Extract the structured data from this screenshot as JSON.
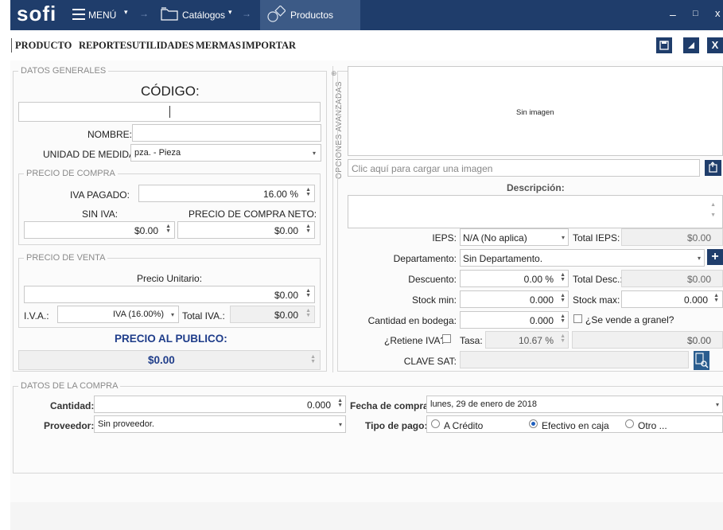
{
  "app": {
    "logo": "sofi",
    "menu_label": "MENÚ",
    "catalogos_label": "Catálogos",
    "productos_label": "Productos",
    "window_controls": {
      "minimize": "–",
      "maximize": "□",
      "close": "x"
    }
  },
  "menubar": {
    "items": [
      "PRODUCTO",
      "REPORTES",
      "UTILIDADES",
      "MERMAS",
      "IMPORTAR"
    ],
    "icons": [
      "save-icon",
      "clear-icon",
      "close-icon"
    ],
    "close_label": "X"
  },
  "datos_generales": {
    "legend": "DATOS GENERALES",
    "codigo_label": "CÓDIGO:",
    "codigo_value": "",
    "nombre_label": "NOMBRE:",
    "nombre_value": "",
    "unidad_label": "UNIDAD DE MEDIDA:",
    "unidad_value": "pza. - Pieza"
  },
  "precio_compra": {
    "legend": "PRECIO DE COMPRA",
    "iva_pagado_label": "IVA PAGADO:",
    "iva_pagado_value": "16.00 %",
    "sin_iva_label": "SIN IVA:",
    "sin_iva_value": "$0.00",
    "neto_label": "PRECIO DE COMPRA NETO:",
    "neto_value": "$0.00"
  },
  "precio_venta": {
    "legend": "PRECIO DE VENTA",
    "unitario_label": "Precio Unitario:",
    "unitario_value": "$0.00",
    "iva_label": "I.V.A.:",
    "iva_value": "IVA (16.00%)",
    "total_iva_label": "Total IVA.:",
    "total_iva_value": "$0.00"
  },
  "publico": {
    "label": "PRECIO AL PUBLICO:",
    "value": "$0.00"
  },
  "advanced": {
    "tab_label": "OPCIONES AVANZADAS",
    "image_placeholder": "Sin imagen",
    "image_hint": "Clic aquí para cargar una imagen",
    "descripcion_label": "Descripción:",
    "ieps_label": "IEPS:",
    "ieps_value": "N/A (No aplica)",
    "total_ieps_label": "Total IEPS:",
    "total_ieps_value": "$0.00",
    "departamento_label": "Departamento:",
    "departamento_value": "Sin Departamento.",
    "descuento_label": "Descuento:",
    "descuento_value": "0.00 %",
    "total_desc_label": "Total Desc.:",
    "total_desc_value": "$0.00",
    "stock_min_label": "Stock min:",
    "stock_min_value": "0.000",
    "stock_max_label": "Stock max:",
    "stock_max_value": "0.000",
    "cantidad_bodega_label": "Cantidad en bodega:",
    "cantidad_bodega_value": "0.000",
    "granel_label": "¿Se vende a granel?",
    "retiene_label": "¿Retiene IVA?",
    "tasa_label": "Tasa:",
    "tasa_value": "10.67 %",
    "retiene_value": "$0.00",
    "clave_sat_label": "CLAVE SAT:",
    "clave_sat_value": ""
  },
  "datos_compra": {
    "legend": "DATOS DE LA COMPRA",
    "cantidad_label": "Cantidad:",
    "cantidad_value": "0.000",
    "fecha_label": "Fecha de compra:",
    "fecha_value": "lunes, 29 de enero de 2018",
    "proveedor_label": "Proveedor:",
    "proveedor_value": "Sin proveedor.",
    "tipo_pago_label": "Tipo de pago:",
    "tipo_pago_options": [
      "A Crédito",
      "Efectivo en caja",
      "Otro ..."
    ],
    "tipo_pago_selected": "Efectivo en caja"
  },
  "colors": {
    "titlebar": "#1f3d6b",
    "accent": "#1f3d8a"
  }
}
